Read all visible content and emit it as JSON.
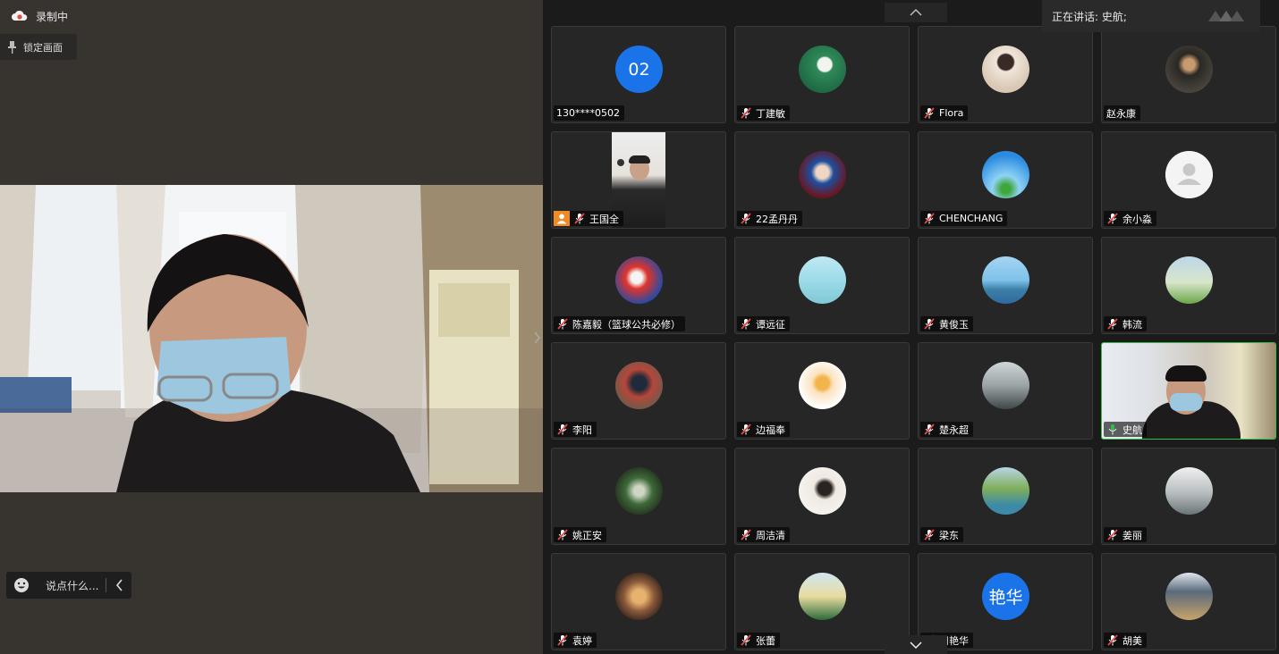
{
  "recording": {
    "label": "录制中",
    "icon": "cloud-record-icon"
  },
  "lock_button": {
    "label": "锁定画面",
    "icon": "pin-icon"
  },
  "chat": {
    "placeholder": "说点什么...",
    "icon": "emoji-icon",
    "collapse_icon": "chevron-left-icon"
  },
  "speaking": {
    "label": "正在讲话: 史航;"
  },
  "scroll": {
    "up_icon": "chevron-up-icon",
    "down_icon": "chevron-down-icon"
  },
  "colors": {
    "accent_blue": "#1a73e8",
    "active_green": "#2fbf4a",
    "mic_muted": "#e04b4b",
    "mic_on": "#2fbf4a",
    "host_badge": "#f08a24"
  },
  "participants": [
    {
      "name": "130****0502",
      "avatar_text": "02",
      "muted": false,
      "no_mic": true
    },
    {
      "name": "丁建敏",
      "muted": true
    },
    {
      "name": "Flora",
      "muted": true
    },
    {
      "name": "赵永康",
      "muted": false,
      "no_mic": true
    },
    {
      "name": "王国全",
      "muted": true,
      "host": true,
      "video": true
    },
    {
      "name": "22孟丹丹",
      "muted": true
    },
    {
      "name": "CHENCHANG",
      "muted": true
    },
    {
      "name": "余小淼",
      "muted": true
    },
    {
      "name": "陈嘉毅（篮球公共必修）",
      "muted": true
    },
    {
      "name": "谭远征",
      "muted": true
    },
    {
      "name": "黄俊玉",
      "muted": true
    },
    {
      "name": "韩流",
      "muted": true
    },
    {
      "name": "李阳",
      "muted": true
    },
    {
      "name": "边福奉",
      "muted": true
    },
    {
      "name": "楚永超",
      "muted": true
    },
    {
      "name": "史航",
      "muted": false,
      "speaking": true,
      "video": true
    },
    {
      "name": "姚正安",
      "muted": true
    },
    {
      "name": "周洁清",
      "muted": true
    },
    {
      "name": "梁东",
      "muted": true
    },
    {
      "name": "姜丽",
      "muted": true
    },
    {
      "name": "袁婷",
      "muted": true
    },
    {
      "name": "张蕾",
      "muted": true
    },
    {
      "name": "周艳华",
      "avatar_text": "艳华",
      "muted": true
    },
    {
      "name": "胡美",
      "muted": true
    }
  ]
}
